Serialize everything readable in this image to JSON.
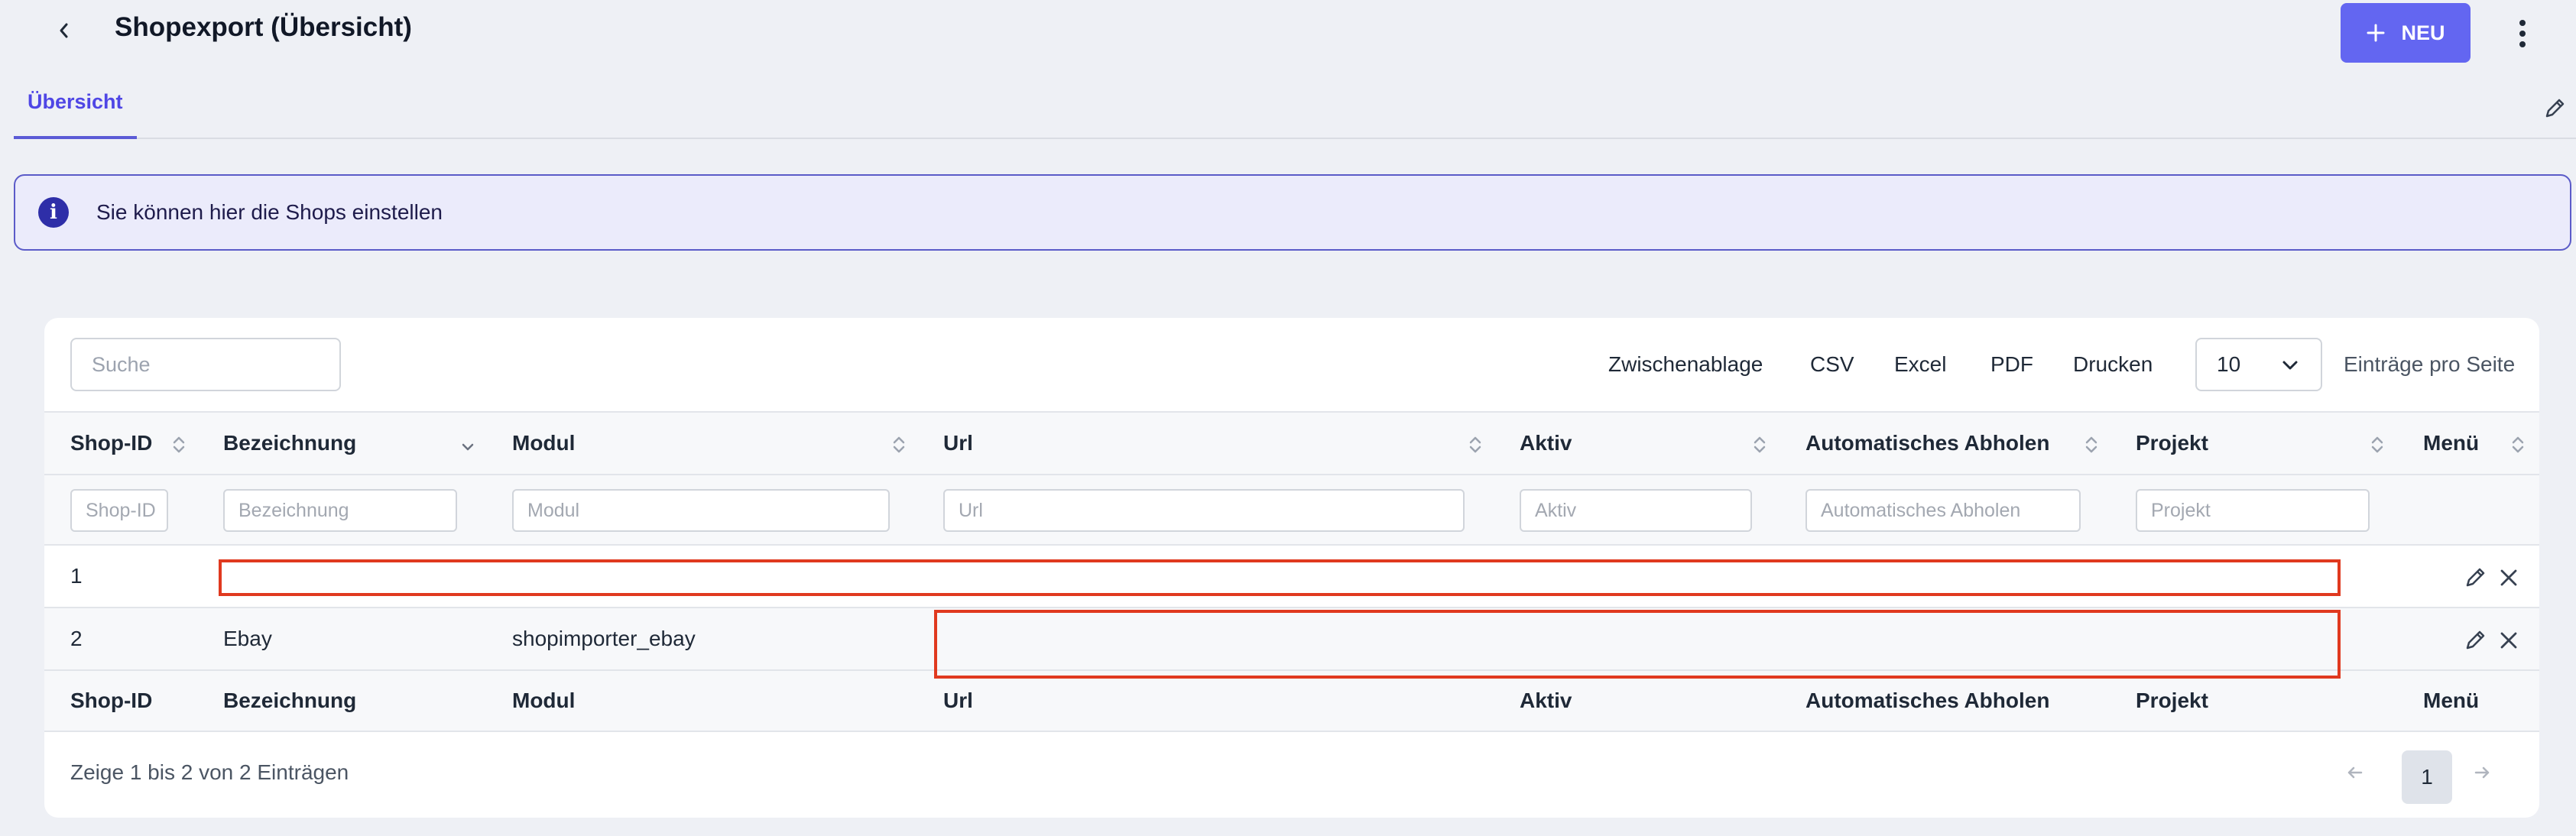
{
  "header": {
    "title": "Shopexport (Übersicht)",
    "new_label": "NEU"
  },
  "tabs": [
    {
      "label": "Übersicht",
      "active": true
    }
  ],
  "info": {
    "text": "Sie können hier die Shops einstellen"
  },
  "toolbar": {
    "search_placeholder": "Suche",
    "exports": [
      "Zwischenablage",
      "CSV",
      "Excel",
      "PDF",
      "Drucken"
    ],
    "per_page_value": "10",
    "per_page_label": "Einträge pro Seite"
  },
  "table": {
    "columns": [
      "Shop-ID",
      "Bezeichnung",
      "Modul",
      "Url",
      "Aktiv",
      "Automatisches Abholen",
      "Projekt",
      "Menü"
    ],
    "filter_placeholders": [
      "Shop-ID",
      "Bezeichnung",
      "Modul",
      "Url",
      "Aktiv",
      "Automatisches Abholen",
      "Projekt"
    ],
    "rows": [
      {
        "shop_id": "1",
        "bezeichnung": "",
        "modul": "",
        "url": "",
        "aktiv": "",
        "auto": "",
        "projekt": ""
      },
      {
        "shop_id": "2",
        "bezeichnung": "Ebay",
        "modul": "shopimporter_ebay",
        "url": "",
        "aktiv": "",
        "auto": "",
        "projekt": ""
      }
    ]
  },
  "pagination": {
    "summary": "Zeige 1 bis 2 von 2 Einträgen",
    "current_page": "1"
  },
  "colors": {
    "accent": "#6366f1",
    "info_bg": "#ebebfb",
    "highlight": "#e0391f"
  }
}
